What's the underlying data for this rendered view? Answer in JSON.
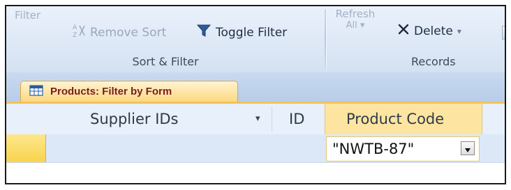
{
  "ribbon": {
    "sort_filter_group": {
      "filter_label": "Filter",
      "remove_sort_label": "Remove Sort",
      "toggle_filter_label": "Toggle Filter",
      "group_label": "Sort & Filter"
    },
    "records_group": {
      "refresh_label_line1": "Refresh",
      "refresh_label_line2": "All",
      "delete_label": "Delete",
      "group_label": "Records"
    }
  },
  "tab": {
    "label": "Products: Filter by Form",
    "accent_color": "#fbd983"
  },
  "sheet": {
    "columns": [
      {
        "label": "Supplier IDs"
      },
      {
        "label": "ID"
      },
      {
        "label": "Product Code"
      }
    ],
    "filter_value": "\"NWTB-87\""
  },
  "icons": [
    "sort-clear-icon",
    "funnel-icon",
    "refresh-icon",
    "delete-x-icon",
    "table-icon",
    "dropdown-arrow-icon"
  ]
}
